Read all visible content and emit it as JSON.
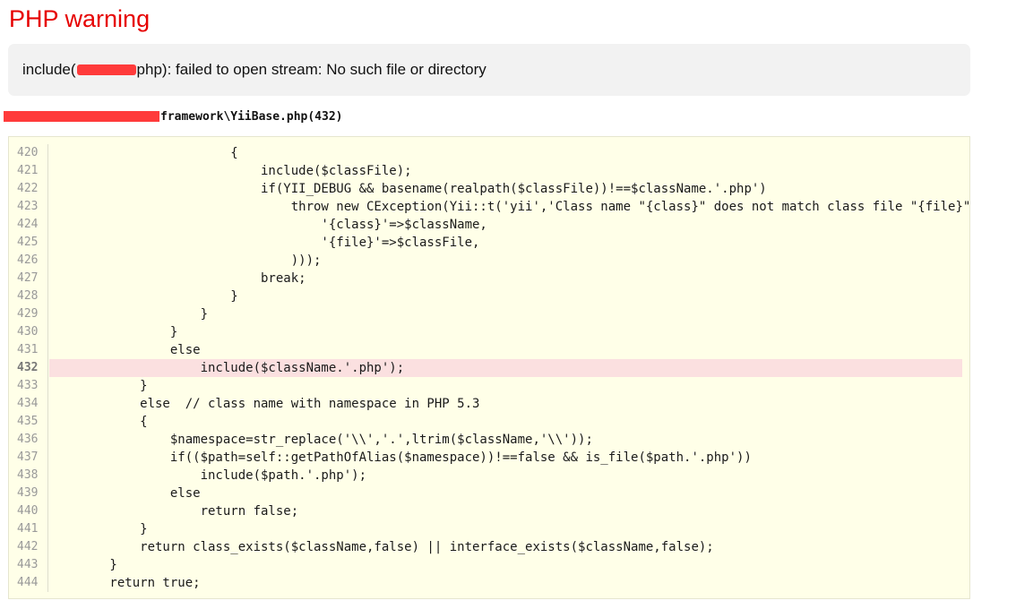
{
  "error": {
    "title": "PHP warning",
    "message_prefix": "include(",
    "message_suffix": "php): failed to open stream: No such file or directory"
  },
  "source": {
    "file_label": "framework\\YiiBase.php(432)",
    "highlight_line": 432,
    "lines": [
      {
        "num": "420",
        "code": "                        {"
      },
      {
        "num": "421",
        "code": "                            include($classFile);"
      },
      {
        "num": "422",
        "code": "                            if(YII_DEBUG && basename(realpath($classFile))!==$className.'.php')"
      },
      {
        "num": "423",
        "code": "                                throw new CException(Yii::t('yii','Class name \"{class}\" does not match class file \"{file}\"', array("
      },
      {
        "num": "424",
        "code": "                                    '{class}'=>$className,"
      },
      {
        "num": "425",
        "code": "                                    '{file}'=>$classFile,"
      },
      {
        "num": "426",
        "code": "                                )));"
      },
      {
        "num": "427",
        "code": "                            break;"
      },
      {
        "num": "428",
        "code": "                        }"
      },
      {
        "num": "429",
        "code": "                    }"
      },
      {
        "num": "430",
        "code": "                }"
      },
      {
        "num": "431",
        "code": "                else"
      },
      {
        "num": "432",
        "code": "                    include($className.'.php');"
      },
      {
        "num": "433",
        "code": "            }"
      },
      {
        "num": "434",
        "code": "            else  // class name with namespace in PHP 5.3"
      },
      {
        "num": "435",
        "code": "            {"
      },
      {
        "num": "436",
        "code": "                $namespace=str_replace('\\\\','.',ltrim($className,'\\\\'));"
      },
      {
        "num": "437",
        "code": "                if(($path=self::getPathOfAlias($namespace))!==false && is_file($path.'.php'))"
      },
      {
        "num": "438",
        "code": "                    include($path.'.php');"
      },
      {
        "num": "439",
        "code": "                else"
      },
      {
        "num": "440",
        "code": "                    return false;"
      },
      {
        "num": "441",
        "code": "            }"
      },
      {
        "num": "442",
        "code": "            return class_exists($className,false) || interface_exists($className,false);"
      },
      {
        "num": "443",
        "code": "        }"
      },
      {
        "num": "444",
        "code": "        return true;"
      }
    ]
  }
}
